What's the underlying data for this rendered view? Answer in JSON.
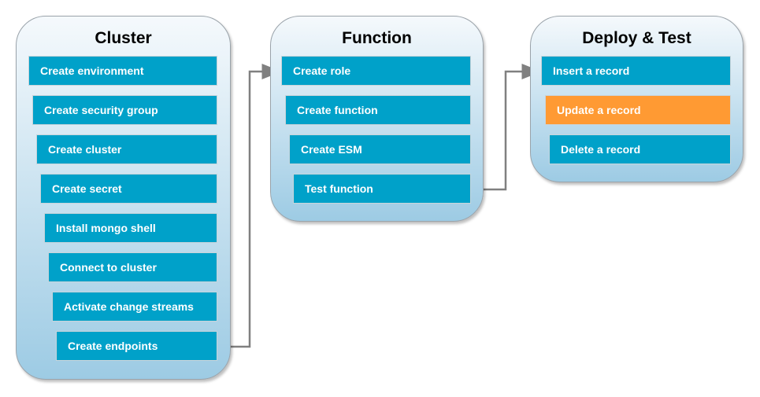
{
  "groups": [
    {
      "title": "Cluster",
      "steps": [
        "Create environment",
        "Create security group",
        "Create cluster",
        "Create secret",
        "Install mongo shell",
        "Connect to cluster",
        "Activate change streams",
        "Create endpoints"
      ]
    },
    {
      "title": "Function",
      "steps": [
        "Create role",
        "Create function",
        "Create ESM",
        "Test function"
      ]
    },
    {
      "title": "Deploy & Test",
      "steps": [
        "Insert a record",
        "Update a record",
        "Delete a record"
      ]
    }
  ],
  "highlighted_step": "Update a record",
  "colors": {
    "step": "#00a1c9",
    "highlight": "#ff9a33",
    "arrow": "#808080"
  }
}
